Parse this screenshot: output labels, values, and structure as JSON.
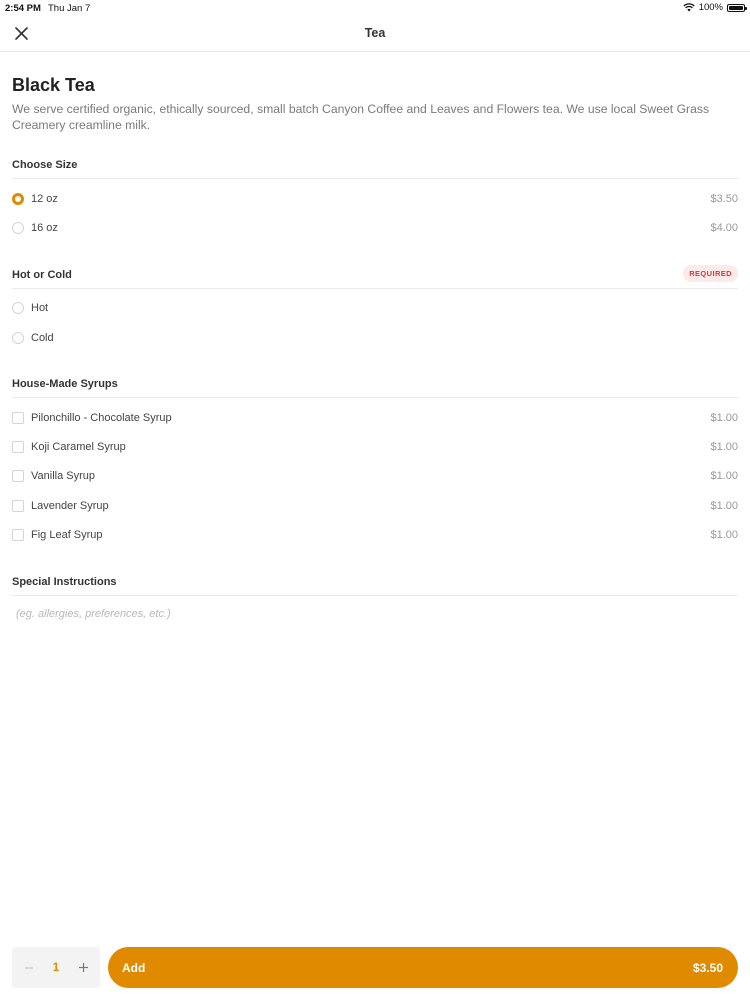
{
  "status_bar": {
    "time": "2:54 PM",
    "date": "Thu Jan 7",
    "battery": "100%"
  },
  "nav": {
    "title": "Tea",
    "close_icon": "close-icon"
  },
  "item": {
    "title": "Black Tea",
    "description": "We serve certified organic, ethically sourced, small batch Canyon Coffee and Leaves and Flowers tea. We use local Sweet Grass Creamery creamline milk."
  },
  "size_section": {
    "title": "Choose Size",
    "options": [
      {
        "label": "12 oz",
        "price": "$3.50",
        "selected": true
      },
      {
        "label": "16 oz",
        "price": "$4.00",
        "selected": false
      }
    ]
  },
  "temp_section": {
    "title": "Hot or Cold",
    "badge": "REQUIRED",
    "options": [
      {
        "label": "Hot",
        "selected": false
      },
      {
        "label": "Cold",
        "selected": false
      }
    ]
  },
  "syrup_section": {
    "title": "House-Made Syrups",
    "options": [
      {
        "label": "Pilonchillo - Chocolate Syrup",
        "price": "$1.00"
      },
      {
        "label": "Koji Caramel Syrup",
        "price": "$1.00"
      },
      {
        "label": "Vanilla Syrup",
        "price": "$1.00"
      },
      {
        "label": "Lavender Syrup",
        "price": "$1.00"
      },
      {
        "label": "Fig Leaf Syrup",
        "price": "$1.00"
      }
    ]
  },
  "instructions": {
    "title": "Special Instructions",
    "placeholder": "(eg. allergies, preferences, etc.)",
    "value": ""
  },
  "footer": {
    "quantity": "1",
    "add_label": "Add",
    "total": "$3.50"
  },
  "colors": {
    "accent": "#e08a00",
    "required_bg": "#fdeaea",
    "required_text": "#d23b3b"
  }
}
